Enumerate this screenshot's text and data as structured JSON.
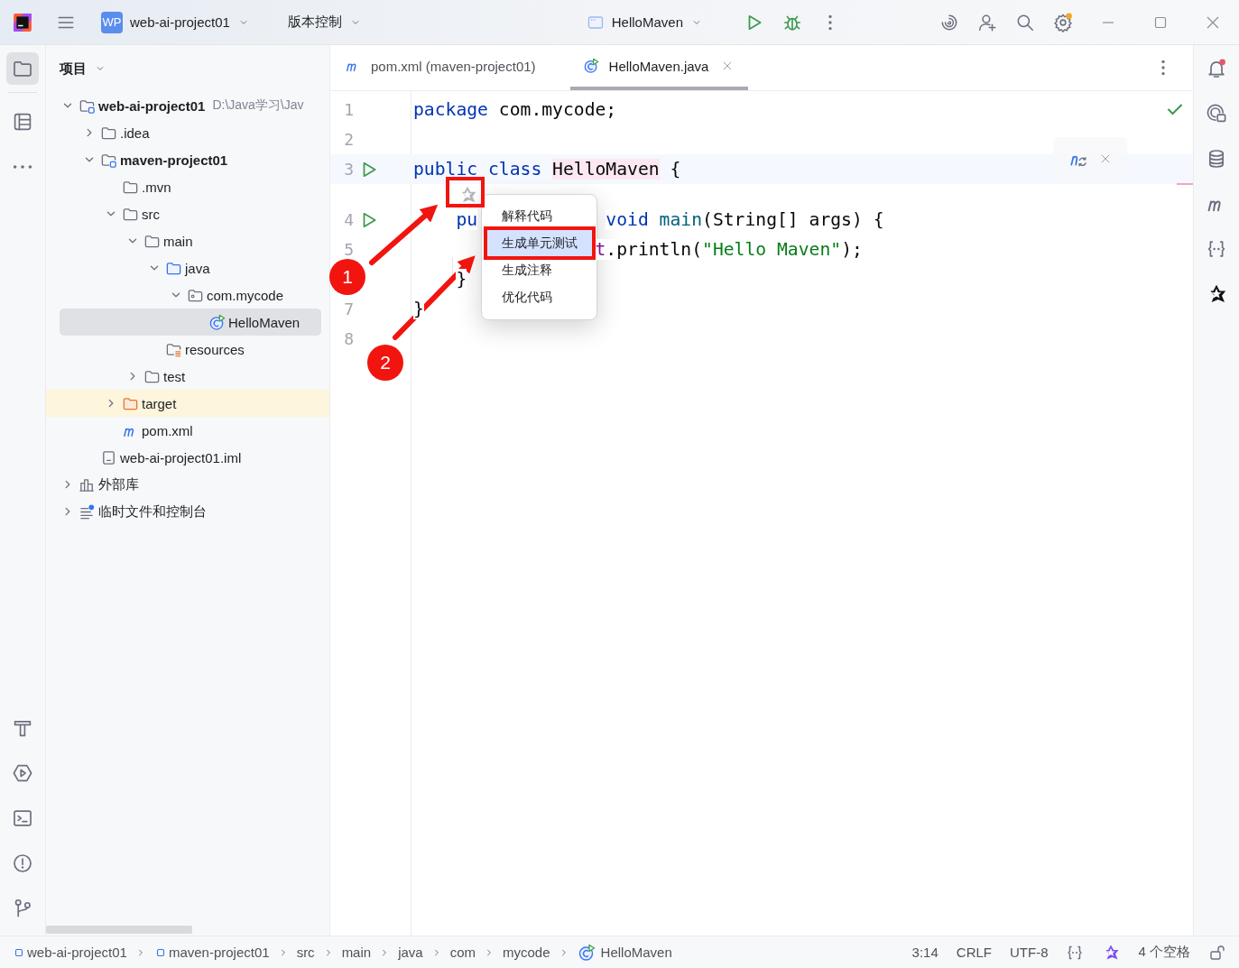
{
  "title_bar": {
    "project_badge": "WP",
    "project": "web-ai-project01",
    "vcs": "版本控制",
    "run_config": "HelloMaven"
  },
  "project_panel": {
    "title": "项目",
    "tree": [
      {
        "label": "web-ai-project01",
        "kind": "module",
        "path": "D:\\Java学习\\Jav",
        "expanded": true,
        "selected": false,
        "children": [
          {
            "label": ".idea",
            "kind": "folder",
            "expanded": false,
            "selected": false
          },
          {
            "label": "maven-project01",
            "kind": "module",
            "expanded": true,
            "selected": false,
            "children": [
              {
                "label": ".mvn",
                "kind": "folder",
                "selected": false
              },
              {
                "label": "src",
                "kind": "folder",
                "expanded": true,
                "selected": false,
                "children": [
                  {
                    "label": "main",
                    "kind": "folder",
                    "expanded": true,
                    "selected": false,
                    "children": [
                      {
                        "label": "java",
                        "kind": "source",
                        "expanded": true,
                        "selected": false,
                        "children": [
                          {
                            "label": "com.mycode",
                            "kind": "package",
                            "expanded": true,
                            "selected": false,
                            "children": [
                              {
                                "label": "HelloMaven",
                                "kind": "class",
                                "selected": true
                              }
                            ]
                          }
                        ]
                      },
                      {
                        "label": "resources",
                        "kind": "resources",
                        "selected": false
                      }
                    ]
                  },
                  {
                    "label": "test",
                    "kind": "folder",
                    "expanded": false,
                    "selected": false
                  }
                ]
              },
              {
                "label": "target",
                "kind": "excluded",
                "expanded": false,
                "selected": false
              },
              {
                "label": "pom.xml",
                "kind": "maven",
                "selected": false
              }
            ]
          },
          {
            "label": "web-ai-project01.iml",
            "kind": "iml",
            "selected": false
          }
        ]
      },
      {
        "label": "外部库",
        "kind": "libraries",
        "expanded": false,
        "selected": false
      },
      {
        "label": "临时文件和控制台",
        "kind": "scratches",
        "expanded": false,
        "selected": false
      }
    ]
  },
  "tabs": [
    {
      "label": "pom.xml (maven-project01)",
      "kind": "maven",
      "selected": false,
      "closable": false
    },
    {
      "label": "HelloMaven.java",
      "kind": "class",
      "selected": true,
      "closable": true
    }
  ],
  "editor": {
    "lines": [
      {
        "number": "1",
        "current": false,
        "run": false,
        "hint_above": false,
        "segments": [
          [
            {
              "t": "package",
              "color": "#0033b3"
            },
            {
              "t": " com.mycode;"
            }
          ]
        ]
      },
      {
        "number": "2",
        "current": false,
        "run": false,
        "hint_above": false
      },
      {
        "number": "3",
        "current": true,
        "run": true,
        "hint_above": false,
        "segments": [
          [
            {
              "t": "public class ",
              "color": "#0033b3"
            },
            {
              "t": "HelloMaven",
              "highlighted": true
            },
            {
              "t": " {"
            }
          ]
        ]
      },
      {
        "number": "4",
        "current": false,
        "run": true,
        "hint_above": true,
        "segments": [
          [
            {
              "t": "    pu",
              "color": "#0033b3"
            }
          ],
          [
            {
              "t": "                  void",
              "color": "#0033b3"
            },
            {
              "t": " main",
              "color": "#00627a"
            },
            {
              "t": "(String[] args) {"
            }
          ]
        ]
      },
      {
        "number": "5",
        "current": false,
        "run": false,
        "hint_above": false,
        "segments": [
          [
            {
              "t": "                 t",
              "color": "#871094"
            },
            {
              "t": ".println("
            },
            {
              "t": "\"Hello Maven\"",
              "color": "#067d17"
            },
            {
              "t": ");"
            }
          ]
        ]
      },
      {
        "current": false,
        "run": false,
        "hint_above": false,
        "segments": [
          [
            {
              "t": "    }"
            }
          ]
        ]
      },
      {
        "number": "7",
        "current": false,
        "run": false,
        "hint_above": false,
        "segments": [
          [
            {
              "t": "}"
            }
          ]
        ]
      },
      {
        "number": "8",
        "current": false,
        "run": false,
        "hint_above": false
      }
    ],
    "popup": [
      {
        "label": "解释代码",
        "selected": false
      },
      {
        "label": "生成单元测试",
        "selected": true
      },
      {
        "label": "生成注释",
        "selected": false
      },
      {
        "label": "优化代码",
        "selected": false
      }
    ]
  },
  "annotations": [
    {
      "label": "1"
    },
    {
      "label": "2"
    }
  ],
  "status_bar": {
    "breadcrumbs": [
      {
        "label": "web-ai-project01",
        "kind": "module"
      },
      {
        "label": "maven-project01",
        "kind": "module"
      },
      {
        "label": "src",
        "kind": "plain"
      },
      {
        "label": "main",
        "kind": "plain"
      },
      {
        "label": "java",
        "kind": "plain"
      },
      {
        "label": "com",
        "kind": "plain"
      },
      {
        "label": "mycode",
        "kind": "plain"
      },
      {
        "label": "HelloMaven",
        "kind": "class"
      }
    ],
    "position": "3:14",
    "line_separator": "CRLF",
    "encoding": "UTF-8",
    "indent": "4 个空格"
  }
}
